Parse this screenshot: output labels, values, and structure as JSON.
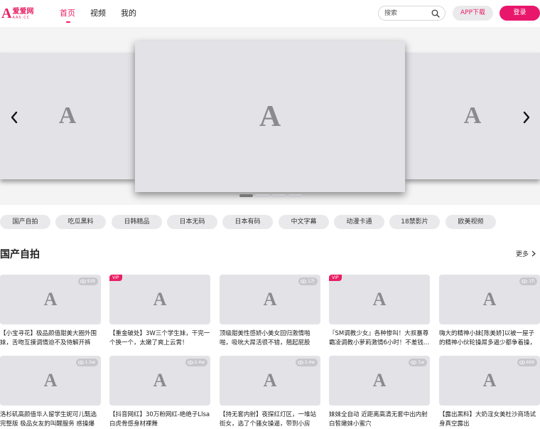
{
  "header": {
    "logo": {
      "glyph": "A",
      "name": "爱爱网",
      "sub": "AAS.CC"
    },
    "nav": [
      {
        "label": "首页",
        "active": true
      },
      {
        "label": "视频",
        "active": false
      },
      {
        "label": "我的",
        "active": false
      }
    ],
    "search": {
      "placeholder": "搜索",
      "value": ""
    },
    "app_button": "APP下载",
    "login_button": "登录"
  },
  "banner": {
    "placeholder_glyph": "A",
    "slide_count": 4,
    "active_slide": 0
  },
  "categories": [
    "国产自拍",
    "吃瓜黑料",
    "日韩精品",
    "日本无码",
    "日本有码",
    "中文字幕",
    "动漫卡通",
    "18禁影片",
    "欧美视频"
  ],
  "section": {
    "title": "国产自拍",
    "more_label": "更多",
    "placeholder_glyph": "A",
    "videos": [
      {
        "title": "【小宝寻花】极品颜值甜美大圈外围妹，舌吻互摸调情迫不及待解开裤子…",
        "views": "939",
        "vip": false
      },
      {
        "title": "【重金破处】3W三个学生妹，干完一个换一个，太嫩了爽上云霄！",
        "views": "",
        "vip": true
      },
      {
        "title": "顶级甜美性感娇小美女回归激情啪啪，吸吮大屌活很不错，翘起屁股撅…",
        "views": "1万",
        "vip": false
      },
      {
        "title": "『SM调教少女』各种惨叫！大叔暴尊霸凌调教小萝莉激情6小时！不差钱…",
        "views": "",
        "vip": true
      },
      {
        "title": "嗨大的精神小妹[陈美娇]以被一屋子的精神小伙轮操屌多逼少都争着操，天…",
        "views": "1fi",
        "vip": false
      },
      {
        "title": "洛杉矶高颜值华人留学生妮可儿甄选完整版 极品女友的叫醒服务 惑操爆射…",
        "views": "1.5w",
        "vip": false
      },
      {
        "title": "【抖音网红】30万粉网红-绝绝子Llsa白虎骨感身材裸舞",
        "views": "2.4w",
        "vip": false
      },
      {
        "title": "【持无套内射】夜探红灯区，一堆站街女，选了个骚女操逼，带到小房间，…",
        "views": "3.4w",
        "vip": false
      },
      {
        "title": "妹妹全自动 近距离高清无套中出内射白皙嫩妹小蜜穴",
        "views": "1w",
        "vip": false
      },
      {
        "title": "【露出黑料】大奶淫女美杜沙商场试身真空露出",
        "views": "669",
        "vip": false
      }
    ]
  },
  "colors": {
    "accent": "#e91e63",
    "placeholder_bg": "#e3e3e7",
    "chip_bg": "#e9e9eb"
  },
  "icons": {
    "search": "search-icon",
    "prev": "chevron-left-icon",
    "next": "chevron-right-icon",
    "more": "chevron-right-icon",
    "views": "eye-icon"
  }
}
